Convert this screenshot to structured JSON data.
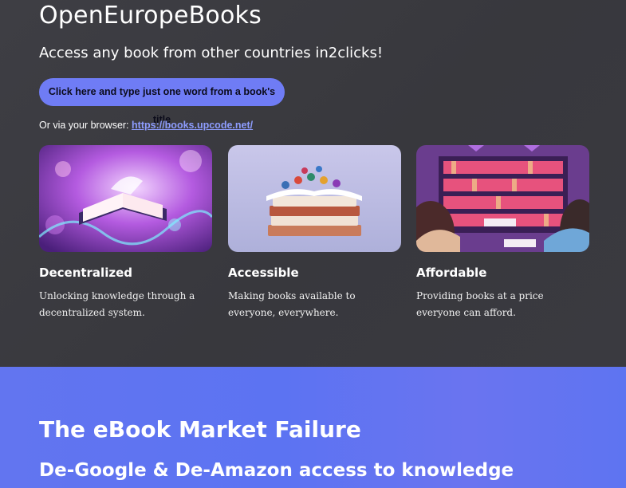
{
  "hero": {
    "title": "OpenEuropeBooks",
    "tagline": "Access any book from other countries in2clicks!",
    "cta_label": "Click here and type just one word from a book's title",
    "browser_prefix": "Or via your browser: ",
    "browser_link": "https://books.upcode.net/"
  },
  "features": [
    {
      "title": "Decentralized",
      "desc": "Unlocking knowledge through a decentralized system."
    },
    {
      "title": "Accessible",
      "desc": "Making books available to everyone, everywhere."
    },
    {
      "title": "Affordable",
      "desc": "Providing books at a price everyone can afford."
    }
  ],
  "market": {
    "title": "The eBook Market Failure",
    "subtitle": "De-Google & De-Amazon access to knowledge"
  },
  "colors": {
    "hero_bg": "#3a3a3f",
    "accent": "#6f7cf5",
    "link": "#8e9dff",
    "market_bg": "#5f74f1"
  }
}
